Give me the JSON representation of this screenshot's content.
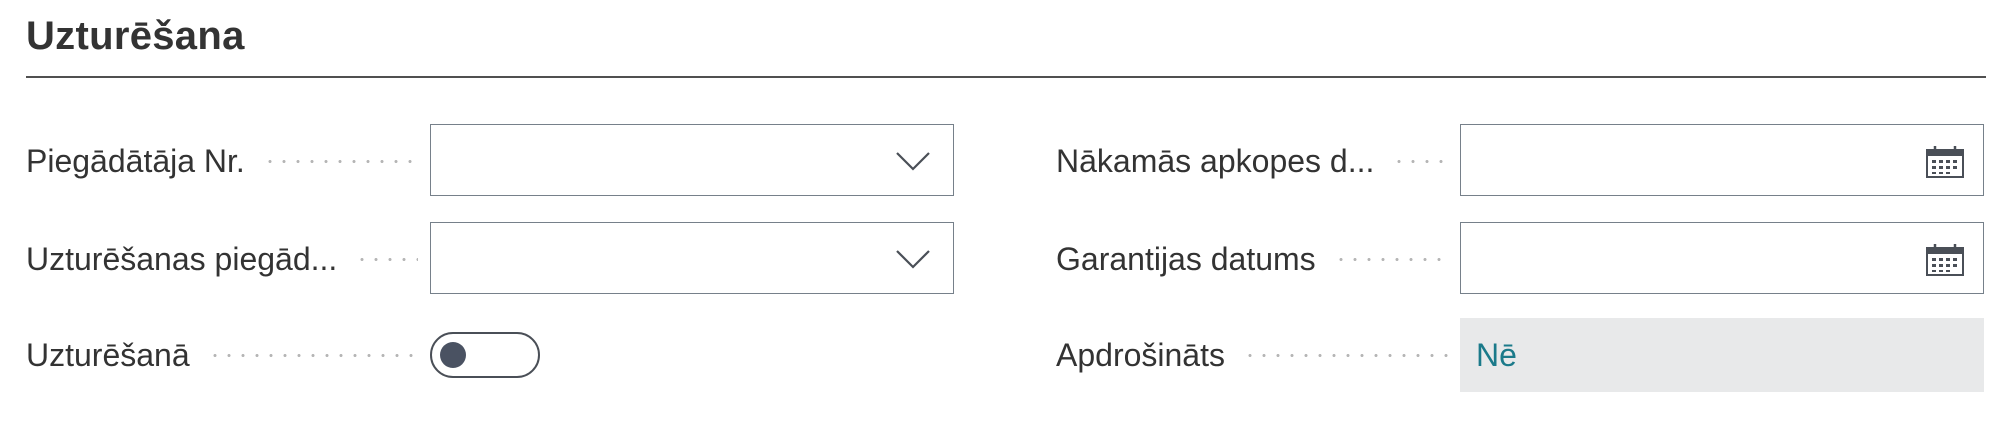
{
  "section": {
    "title": "Uzturēšana"
  },
  "left": {
    "vendor_no": {
      "label": "Piegādātāja Nr.",
      "value": ""
    },
    "maint_vendor": {
      "label": "Uzturēšanas piegād...",
      "value": ""
    },
    "under_maint": {
      "label": "Uzturēšanā",
      "value": false
    }
  },
  "right": {
    "next_service": {
      "label": "Nākamās apkopes d...",
      "value": ""
    },
    "warranty_date": {
      "label": "Garantijas datums",
      "value": ""
    },
    "insured": {
      "label": "Apdrošināts",
      "value": "Nē"
    }
  },
  "icons": {
    "dropdown": "chevron-down-icon",
    "date": "calendar-icon"
  },
  "colors": {
    "readonly_bg": "#e8e9ea",
    "readonly_text": "#1b7a8a",
    "border": "#76808a"
  }
}
